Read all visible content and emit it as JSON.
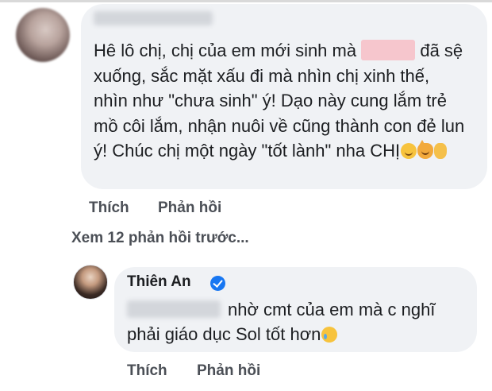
{
  "comment": {
    "text_before_blur": "Hê lô chị, chị của em mới sinh mà",
    "text_after_blur": " đã sệ xuống, sắc mặt xấu đi mà nhìn chị xinh thế, nhìn như \"chưa sinh\" ý! Dạo này cung lắm trẻ mồ côi lắm, nhận nuôi về cũng thành con đẻ lun ý! Chúc chị một ngày \"tốt lành\" nha CHỊ",
    "emojis": [
      "smirk-emoji-icon",
      "smirking-cat-emoji-icon",
      "ok-hand-emoji-icon"
    ],
    "like_label": "Thích",
    "reply_label": "Phản hồi"
  },
  "view_previous_label": "Xem 12 phản hồi trước...",
  "reply": {
    "author": "Thiên An",
    "text": "nhờ cmt của em mà c nghĩ phải giáo dục Sol tốt hơn",
    "emoji": "crying-face-emoji-icon",
    "like_label": "Thích",
    "reply_label": "Phản hồi"
  },
  "colors": {
    "bubble": "#f0f2f5",
    "verified": "#1877f2",
    "action_text": "#4b4f56"
  }
}
